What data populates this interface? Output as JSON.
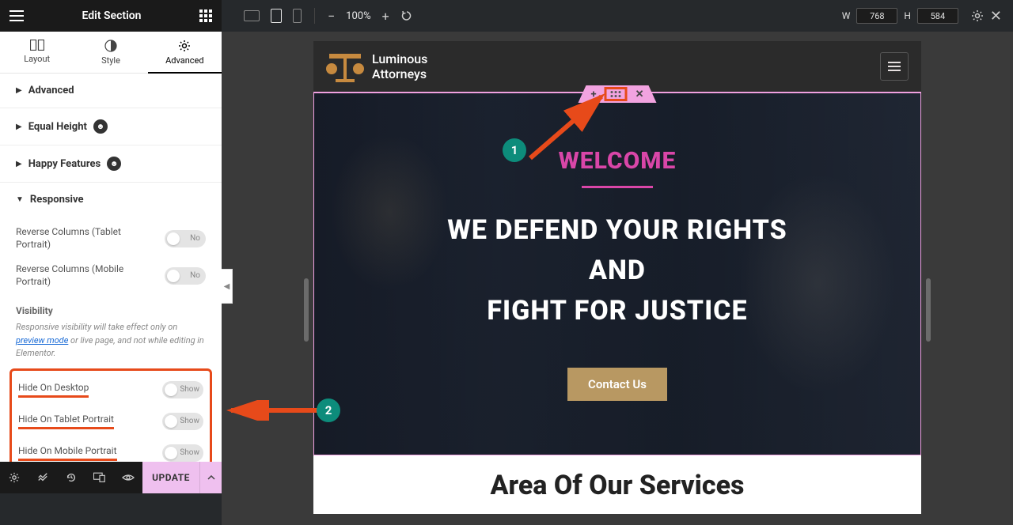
{
  "topbar": {
    "title": "Edit Section",
    "zoom": "100%",
    "width_label": "W",
    "width_value": "768",
    "height_label": "H",
    "height_value": "584"
  },
  "tabs": {
    "layout": "Layout",
    "style": "Style",
    "advanced": "Advanced"
  },
  "accordion": {
    "advanced": "Advanced",
    "equal_height": "Equal Height",
    "happy_features": "Happy Features",
    "responsive": "Responsive"
  },
  "controls": {
    "reverse_tablet": "Reverse Columns (Tablet Portrait)",
    "reverse_mobile": "Reverse Columns (Mobile Portrait)",
    "no": "No",
    "visibility_header": "Visibility",
    "help_pre": "Responsive visibility will take effect only on ",
    "help_link": "preview mode",
    "help_post": " or live page, and not while editing in Elementor.",
    "hide_desktop": "Hide On Desktop",
    "hide_tablet": "Hide On Tablet Portrait",
    "hide_mobile": "Hide On Mobile Portrait",
    "show": "Show"
  },
  "bottombar": {
    "update": "UPDATE"
  },
  "preview": {
    "logo_line1": "Luminous",
    "logo_line2": "Attorneys",
    "welcome": "WELCOME",
    "hero_line1": "WE DEFEND YOUR RIGHTS",
    "hero_line2": "AND",
    "hero_line3": "FIGHT FOR JUSTICE",
    "contact_btn": "Contact Us",
    "services_title": "Area Of Our Services"
  },
  "annotations": {
    "badge1": "1",
    "badge2": "2"
  }
}
